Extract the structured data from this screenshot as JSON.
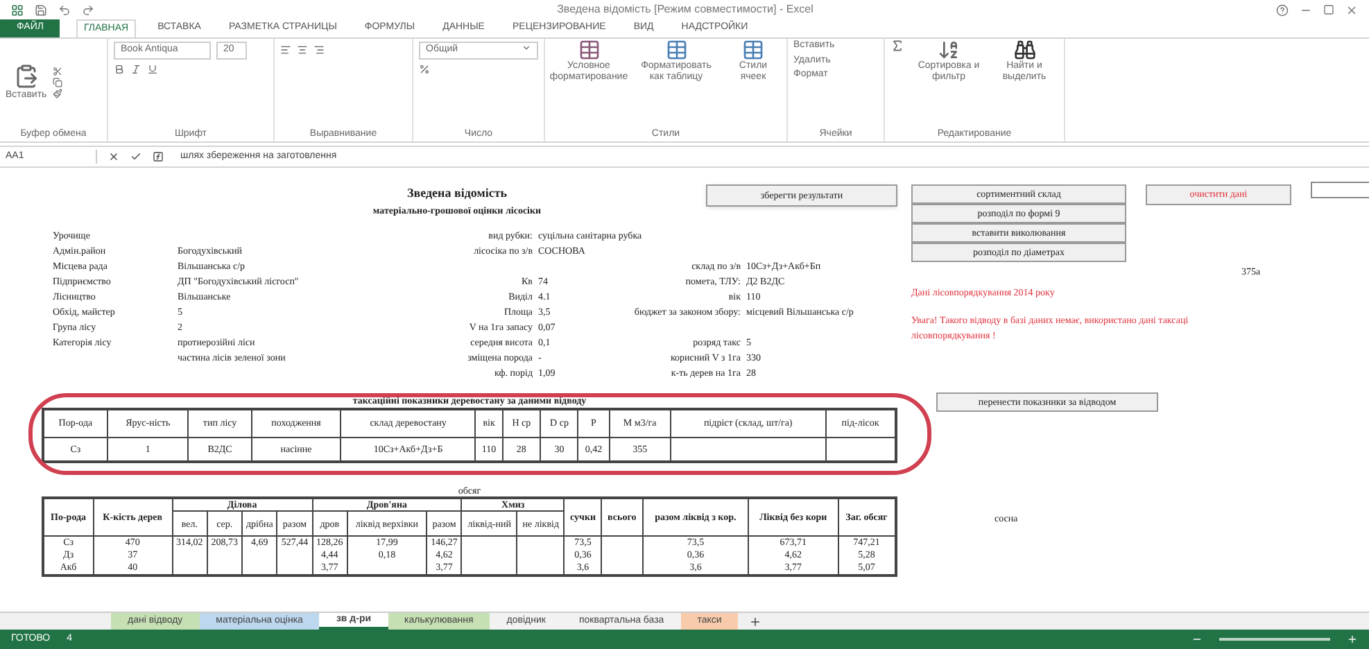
{
  "window": {
    "title": "Зведена відомість [Режим совместимости] - Excel"
  },
  "ribbon_tabs": [
    {
      "label": "ФАЙЛ",
      "selected": false,
      "kind": "file"
    },
    {
      "label": "ГЛАВНАЯ",
      "selected": true,
      "kind": "tab"
    },
    {
      "label": "ВСТАВКА",
      "selected": false,
      "kind": "tab"
    },
    {
      "label": "РАЗМЕТКА СТРАНИЦЫ",
      "selected": false,
      "kind": "tab"
    },
    {
      "label": "ФОРМУЛЫ",
      "selected": false,
      "kind": "tab"
    },
    {
      "label": "ДАННЫЕ",
      "selected": false,
      "kind": "tab"
    },
    {
      "label": "РЕЦЕНЗИРОВАНИЕ",
      "selected": false,
      "kind": "tab"
    },
    {
      "label": "ВИД",
      "selected": false,
      "kind": "tab"
    },
    {
      "label": "НАДСТРОЙКИ",
      "selected": false,
      "kind": "tab"
    }
  ],
  "ribbon": {
    "paste": "Вставить",
    "font_name": "Book Antiqua",
    "font_size": "20",
    "number_format": "Общий",
    "conditional": "Условное форматирование",
    "as_table": "Форматировать как таблицу",
    "cell_styles": "Стили ячеек",
    "insert": "Вставить",
    "delete": "Удалить",
    "format": "Формат",
    "sort": "Сортировка и фильтр",
    "find": "Найти и выделить",
    "groups": [
      "Буфер обмена",
      "Шрифт",
      "Выравнивание",
      "Число",
      "Стили",
      "Ячейки",
      "Редактирование"
    ]
  },
  "formula_bar": {
    "cell": "AA1",
    "formula": "шлях збереження на заготовлення"
  },
  "sheet": {
    "title": "Зведена відомість",
    "subtitle": "матеріально-грошової оцінки лісосіки",
    "info": [
      {
        "left": {
          "label": "Урочище"
        },
        "mid": {
          "label": "вид рубки:",
          "value": "суцільна санітарна рубка"
        }
      },
      {
        "left": {
          "label": "Адмін.район",
          "value": "Богодухівський"
        },
        "mid": {
          "label": "лісосіка по з/в",
          "value": "СОСНОВА"
        }
      },
      {
        "left": {
          "label": "Місцева рада",
          "value": "Вільшанська с/р"
        },
        "right": {
          "label": "склад по з/в",
          "value": "10Сз+Дз+Акб+Бп"
        }
      },
      {
        "left": {
          "label": "Підприємство",
          "value": "ДП \"Богодухівський лісгосп\""
        },
        "mid": {
          "label": "Кв",
          "value": "74"
        },
        "right": {
          "label": "помета, ТЛУ:",
          "value": "Д2 В2ДС"
        }
      },
      {
        "left": {
          "label": "Лісництво",
          "value": "Вільшанське"
        },
        "mid": {
          "label": "Виділ",
          "value": "4.1"
        },
        "right": {
          "label": "вік",
          "value": "110"
        }
      },
      {
        "left": {
          "label": "Обхід, майстер",
          "value": "5"
        },
        "mid": {
          "label": "Площа",
          "value": "3,5"
        },
        "right": {
          "label": "бюджет за законом збору:",
          "value": "місцевий Вільшанська с/р"
        }
      },
      {
        "left": {
          "label": "Група лісу",
          "value": "2"
        },
        "mid": {
          "label": "V на 1га запасу",
          "value": "0,07"
        }
      },
      {
        "left": {
          "label": "Категорія лісу",
          "value": "протиерозійні ліси"
        },
        "mid": {
          "label": "середня висота",
          "value": "0,1"
        },
        "right": {
          "label": "розряд такс",
          "value": "5"
        }
      },
      {
        "left": {
          "value": "частина лісів зеленої зони"
        },
        "mid": {
          "label": "зміщена порода",
          "value": "-"
        },
        "right": {
          "label": "корисний V з 1га",
          "value": "330"
        }
      },
      {
        "mid": {
          "label": "кф. порід",
          "value": "1,09"
        },
        "right": {
          "label": "к-ть дерев на 1га",
          "value": "28"
        }
      }
    ],
    "stand_table": {
      "title": "таксаційні показники деревостану за даними відводу",
      "columns": [
        "Пор-ода",
        "Ярус-ність",
        "тип лісу",
        "походження",
        "склад деревостану",
        "вік",
        "H ср",
        "D ср",
        "P",
        "M м3/га",
        "підріст (склад, шт/га)",
        "під-лісок"
      ],
      "rows": [
        [
          "Сз",
          "1",
          "В2ДС",
          "насінне",
          "10Сз+Акб+Дз+Б",
          "110",
          "28",
          "30",
          "0,42",
          "355",
          null,
          null
        ]
      ]
    },
    "volume_table": {
      "title": "обсяг",
      "headers": [
        {
          "label": "По-рода"
        },
        {
          "label": "К-кість дерев"
        },
        {
          "label": "Ділова",
          "children": [
            "вел.",
            "сер.",
            "дрібна",
            "разом"
          ]
        },
        {
          "label": "Дров'яна",
          "children": [
            "дров",
            "ліквід верхівки",
            "разом"
          ]
        },
        {
          "label": "Хмиз",
          "children": [
            "ліквід-ний",
            "не ліквід"
          ]
        },
        {
          "label": "сучки"
        },
        {
          "label": "всього"
        },
        {
          "label": "разом ліквід з кор."
        },
        {
          "label": "Ліквід без кори"
        },
        {
          "label": "Заг. обсяг"
        }
      ],
      "rows": [
        [
          "Сз",
          "470",
          "314,02",
          "208,73",
          "4,69",
          "527,44",
          "128,26",
          "17,99",
          "146,27",
          null,
          null,
          "73,5",
          null,
          "73,5",
          "673,71",
          "747,21"
        ],
        [
          "Дз",
          "37",
          null,
          null,
          null,
          null,
          "4,44",
          "0,18",
          "4,62",
          null,
          null,
          "0,36",
          null,
          "0,36",
          "4,62",
          "5,28"
        ],
        [
          "Акб",
          "40",
          null,
          null,
          null,
          null,
          "3,77",
          null,
          "3,77",
          null,
          null,
          "3,6",
          null,
          "3,6",
          "3,77",
          "5,07"
        ]
      ]
    },
    "save_button": "зберегти результати",
    "action_buttons": [
      "сортиментний склад",
      "розподіл по формі 9",
      "вставити виколювання",
      "розподіл по діаметрах"
    ],
    "clear_button": "очистити дані",
    "code": "375а",
    "notes": [
      "Дані лісовпорядкування 2014 року",
      "Увага! Такого відводу в базі даних немає, використано дані таксаці",
      "лісовпорядкування !"
    ],
    "transfer_button": "перенести показники за відводом",
    "species": "сосна"
  },
  "sheet_tabs": [
    {
      "label": "дані відводу",
      "selected": false,
      "color": "#c6e0b4"
    },
    {
      "label": "матеріальна оцінка",
      "selected": false,
      "color": "#bdd7ee"
    },
    {
      "label": "зв д-ри",
      "selected": true,
      "color": "#ffffff"
    },
    {
      "label": "калькулювання",
      "selected": false,
      "color": "#c6e0b4"
    },
    {
      "label": "довідник",
      "selected": false,
      "color": "#f2f2f2"
    },
    {
      "label": "поквартальна база",
      "selected": false,
      "color": "#f2f2f2"
    },
    {
      "label": "такси",
      "selected": false,
      "color": "#f8cbad"
    }
  ],
  "status_bar": {
    "state": "ГОТОВО",
    "value": "4"
  }
}
